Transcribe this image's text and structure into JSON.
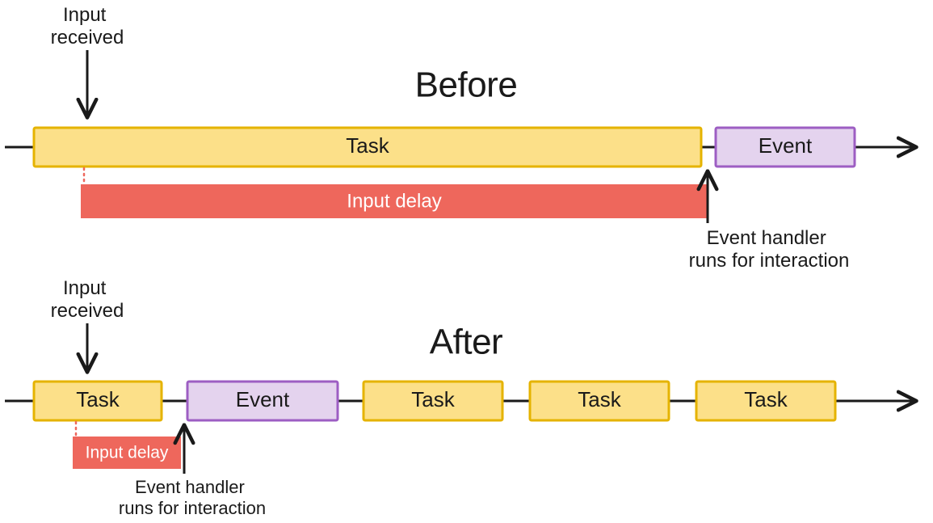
{
  "before": {
    "title": "Before",
    "input_received": "Input\nreceived",
    "task_label": "Task",
    "event_label": "Event",
    "input_delay": "Input delay",
    "handler_note": "Event handler\nruns for interaction"
  },
  "after": {
    "title": "After",
    "input_received": "Input\nreceived",
    "task_label": "Task",
    "event_label": "Event",
    "input_delay": "Input delay",
    "handler_note": "Event handler\nruns for interaction"
  }
}
